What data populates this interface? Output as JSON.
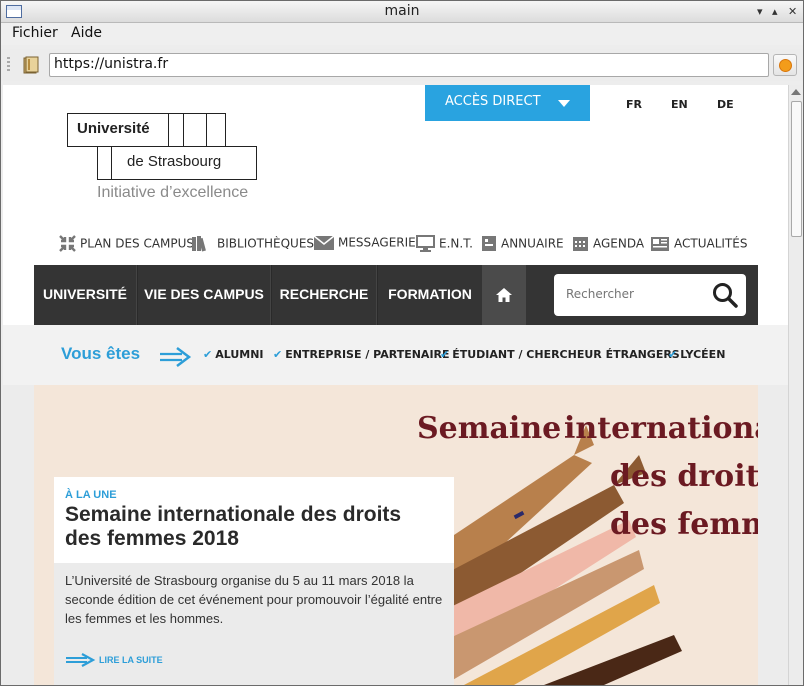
{
  "window": {
    "title": "main"
  },
  "menubar": {
    "items": [
      "Fichier",
      "Aide"
    ]
  },
  "toolbar": {
    "url": "https://unistra.fr"
  },
  "logo": {
    "line1": "Université",
    "line2": "de Strasbourg",
    "tagline": "Initiative d’excellence"
  },
  "header": {
    "acces_direct": "ACCÈS DIRECT",
    "languages": [
      "FR",
      "EN",
      "DE"
    ]
  },
  "utility_nav": [
    {
      "label": "PLAN DES CAMPUS",
      "icon": "compress-arrows-icon"
    },
    {
      "label": "BIBLIOTHÈQUES",
      "icon": "books-icon"
    },
    {
      "label": "MESSAGERIE",
      "icon": "envelope-icon"
    },
    {
      "label": "E.N.T.",
      "icon": "monitor-icon"
    },
    {
      "label": "ANNUAIRE",
      "icon": "address-book-icon"
    },
    {
      "label": "AGENDA",
      "icon": "calendar-icon"
    },
    {
      "label": "ACTUALITÉS",
      "icon": "newspaper-icon"
    }
  ],
  "main_nav": {
    "items": [
      "UNIVERSITÉ",
      "VIE DES CAMPUS",
      "RECHERCHE",
      "FORMATION"
    ],
    "home_icon": "home-icon",
    "search_placeholder": "Rechercher"
  },
  "vous_etes": {
    "title": "Vous êtes",
    "tags": [
      "ALUMNI",
      "ENTREPRISE / PARTENAIRE",
      "ÉTUDIANT / CHERCHEUR ÉTRANGERS",
      "LYCÉEN"
    ]
  },
  "hero": {
    "image_text": [
      "Semaine",
      "internationale",
      "des droits",
      "des femmes"
    ],
    "kicker": "À LA UNE",
    "headline": "Semaine internationale des droits des femmes 2018",
    "description": "L’Université de Strasbourg organise du 5 au 11 mars 2018 la seconde édition de cet événement pour promouvoir l’égalité entre les femmes et les hommes.",
    "read_more": "LIRE LA SUITE"
  },
  "colors": {
    "accent_blue": "#29a3e0",
    "nav_dark": "#343434",
    "hero_bg": "#f4e6d9",
    "hero_title": "#6b1a22"
  }
}
